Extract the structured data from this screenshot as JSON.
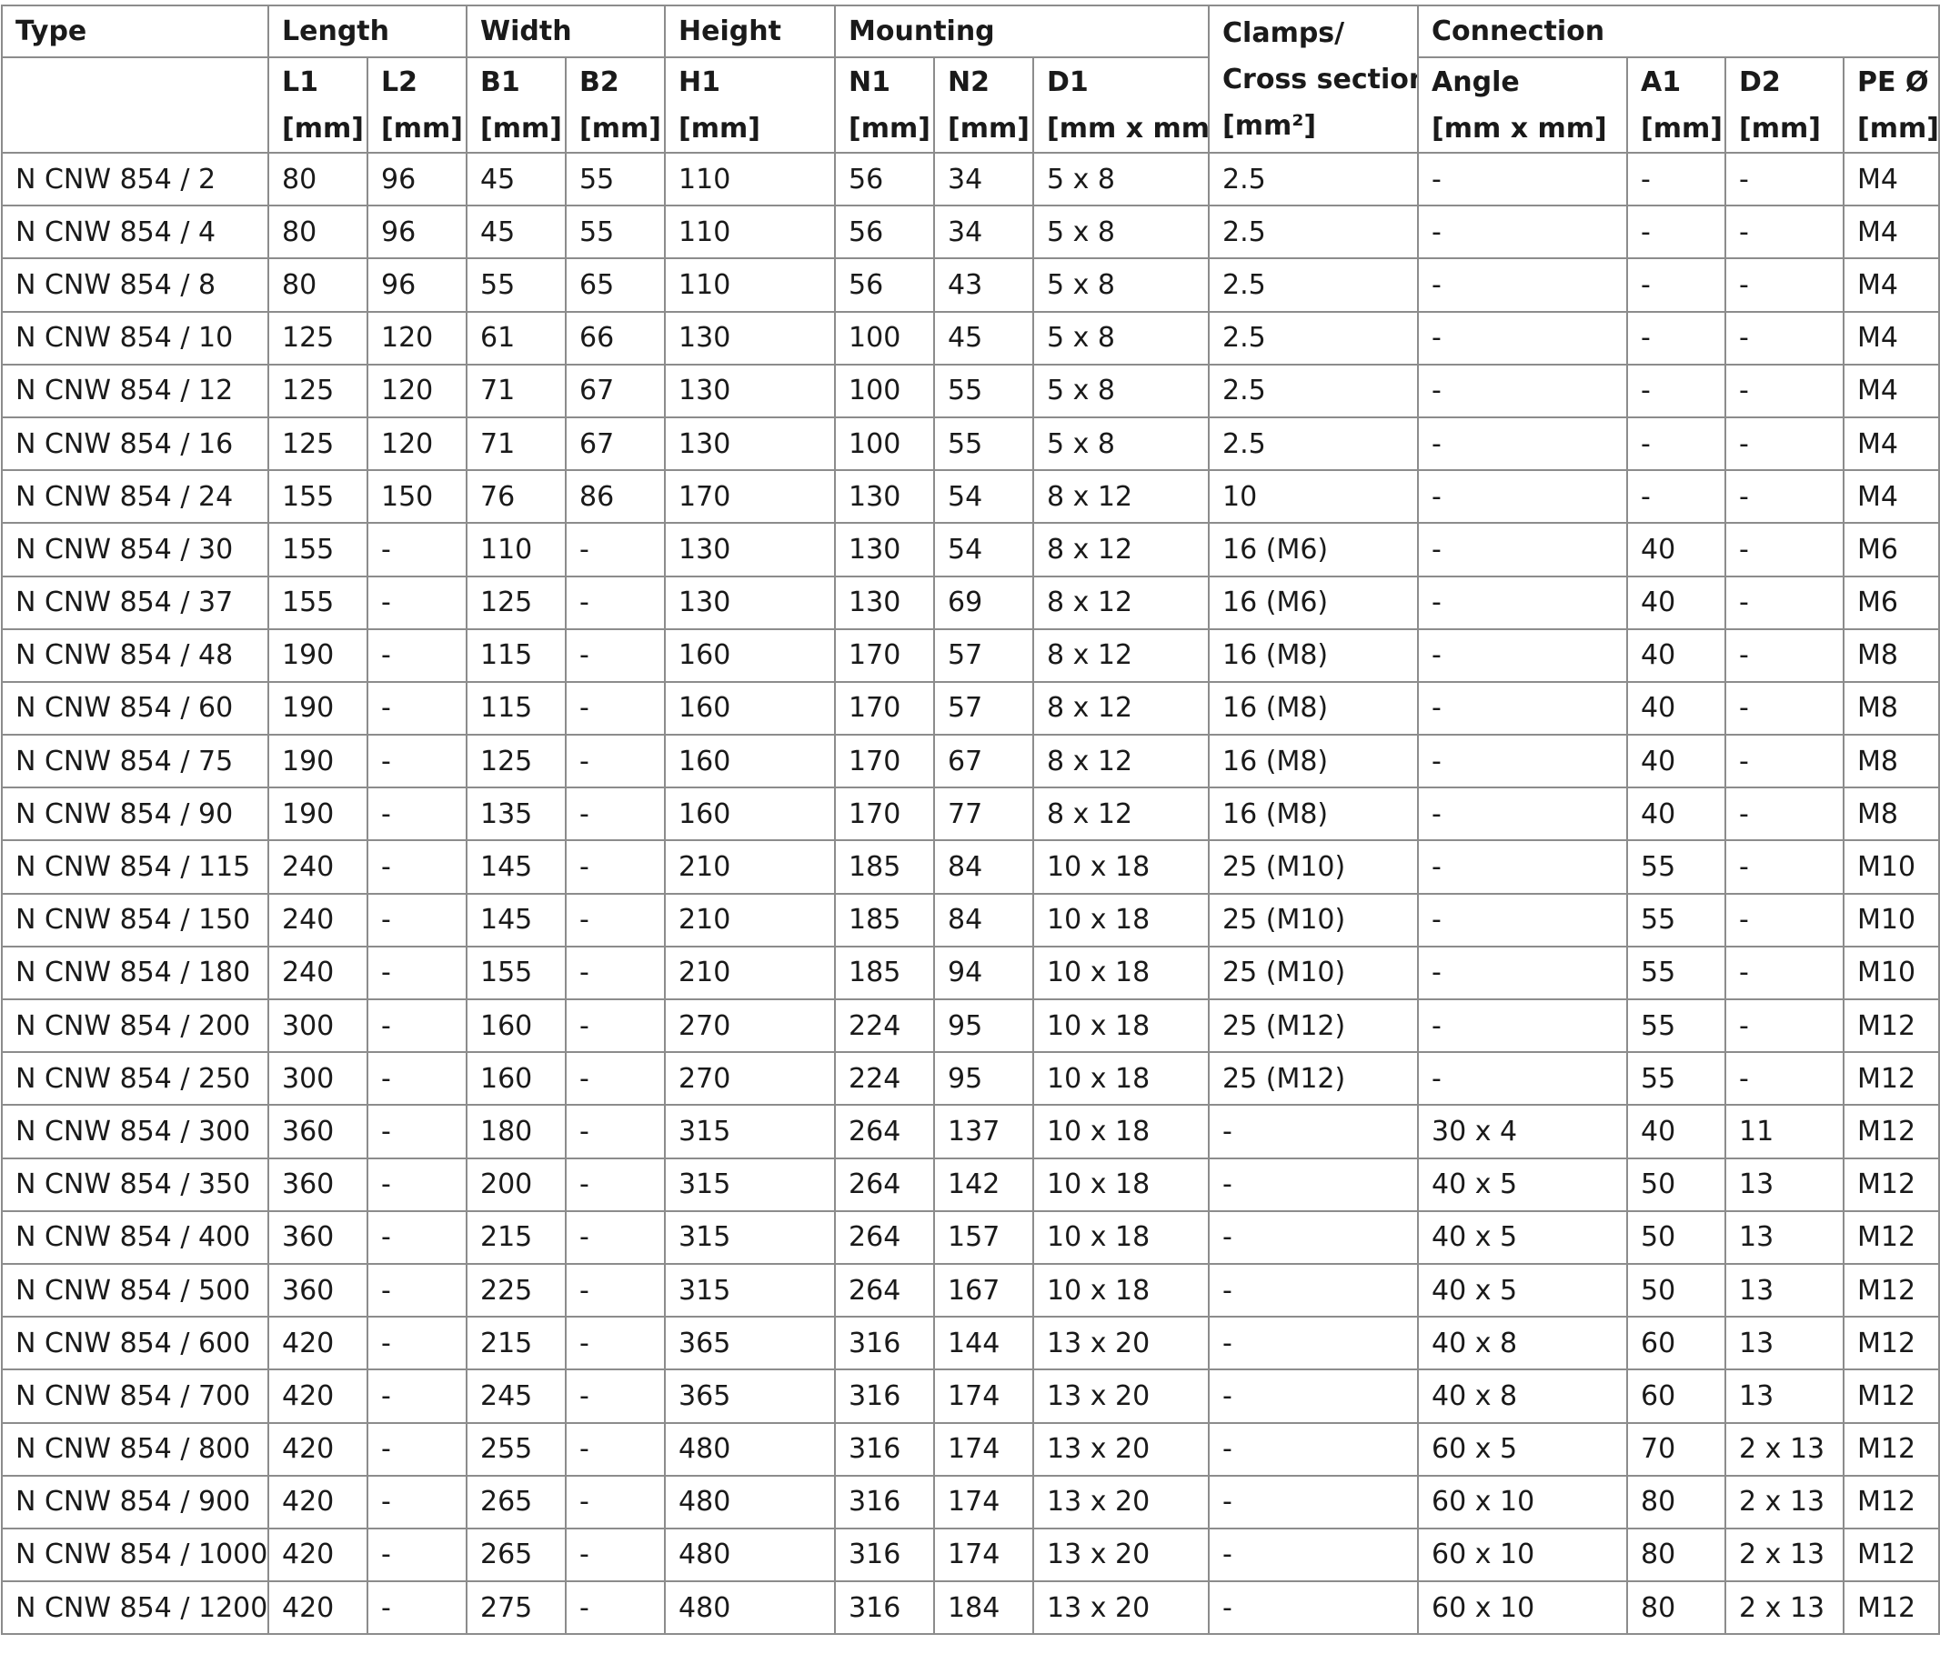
{
  "table": {
    "header": {
      "type": "Type",
      "length": "Length",
      "width": "Width",
      "height": "Height",
      "mounting": "Mounting",
      "clamps_line1": "Clamps/",
      "clamps_line2": "Cross section",
      "clamps_unit": "[mm²]",
      "connection": "Connection"
    },
    "subheaders": [
      {
        "name": "L1",
        "unit": "[mm]"
      },
      {
        "name": "L2",
        "unit": "[mm]"
      },
      {
        "name": "B1",
        "unit": "[mm]"
      },
      {
        "name": "B2",
        "unit": "[mm]"
      },
      {
        "name": "H1",
        "unit": "[mm]"
      },
      {
        "name": "N1",
        "unit": "[mm]"
      },
      {
        "name": "N2",
        "unit": "[mm]"
      },
      {
        "name": "D1",
        "unit": "[mm x mm]"
      },
      {
        "name": "Angle",
        "unit": "[mm x mm]"
      },
      {
        "name": "A1",
        "unit": "[mm]"
      },
      {
        "name": "D2",
        "unit": "[mm]"
      },
      {
        "name": "PE Ø",
        "unit": "[mm]"
      }
    ],
    "rows": [
      [
        "N CNW 854 / 2",
        "80",
        "96",
        "45",
        "55",
        "110",
        "56",
        "34",
        "5 x 8",
        "2.5",
        "-",
        "-",
        "-",
        "M4"
      ],
      [
        "N CNW 854 / 4",
        "80",
        "96",
        "45",
        "55",
        "110",
        "56",
        "34",
        "5 x 8",
        "2.5",
        "-",
        "-",
        "-",
        "M4"
      ],
      [
        "N CNW 854 / 8",
        "80",
        "96",
        "55",
        "65",
        "110",
        "56",
        "43",
        "5 x 8",
        "2.5",
        "-",
        "-",
        "-",
        "M4"
      ],
      [
        "N CNW 854 / 10",
        "125",
        "120",
        "61",
        "66",
        "130",
        "100",
        "45",
        "5 x 8",
        "2.5",
        "-",
        "-",
        "-",
        "M4"
      ],
      [
        "N CNW 854 / 12",
        "125",
        "120",
        "71",
        "67",
        "130",
        "100",
        "55",
        "5 x 8",
        "2.5",
        "-",
        "-",
        "-",
        "M4"
      ],
      [
        "N CNW 854 / 16",
        "125",
        "120",
        "71",
        "67",
        "130",
        "100",
        "55",
        "5 x 8",
        "2.5",
        "-",
        "-",
        "-",
        "M4"
      ],
      [
        "N CNW 854 / 24",
        "155",
        "150",
        "76",
        "86",
        "170",
        "130",
        "54",
        "8 x 12",
        "10",
        "-",
        "-",
        "-",
        "M4"
      ],
      [
        "N CNW 854 / 30",
        "155",
        "-",
        "110",
        "-",
        "130",
        "130",
        "54",
        "8 x 12",
        "16 (M6)",
        "-",
        "40",
        "-",
        "M6"
      ],
      [
        "N CNW 854 / 37",
        "155",
        "-",
        "125",
        "-",
        "130",
        "130",
        "69",
        "8 x 12",
        "16 (M6)",
        "-",
        "40",
        "-",
        "M6"
      ],
      [
        "N CNW 854 / 48",
        "190",
        "-",
        "115",
        "-",
        "160",
        "170",
        "57",
        "8 x 12",
        "16 (M8)",
        "-",
        "40",
        "-",
        "M8"
      ],
      [
        "N CNW 854 / 60",
        "190",
        "-",
        "115",
        "-",
        "160",
        "170",
        "57",
        "8 x 12",
        "16 (M8)",
        "-",
        "40",
        "-",
        "M8"
      ],
      [
        "N CNW 854 / 75",
        "190",
        "-",
        "125",
        "-",
        "160",
        "170",
        "67",
        "8 x 12",
        "16 (M8)",
        "-",
        "40",
        "-",
        "M8"
      ],
      [
        "N CNW 854 / 90",
        "190",
        "-",
        "135",
        "-",
        "160",
        "170",
        "77",
        "8 x 12",
        "16 (M8)",
        "-",
        "40",
        "-",
        "M8"
      ],
      [
        "N CNW 854 / 115",
        "240",
        "-",
        "145",
        "-",
        "210",
        "185",
        "84",
        "10 x 18",
        "25 (M10)",
        "-",
        "55",
        "-",
        "M10"
      ],
      [
        "N CNW 854 / 150",
        "240",
        "-",
        "145",
        "-",
        "210",
        "185",
        "84",
        "10 x 18",
        "25 (M10)",
        "-",
        "55",
        "-",
        "M10"
      ],
      [
        "N CNW 854 / 180",
        "240",
        "-",
        "155",
        "-",
        "210",
        "185",
        "94",
        "10 x 18",
        "25 (M10)",
        "-",
        "55",
        "-",
        "M10"
      ],
      [
        "N CNW 854 / 200",
        "300",
        "-",
        "160",
        "-",
        "270",
        "224",
        "95",
        "10 x 18",
        "25 (M12)",
        "-",
        "55",
        "-",
        "M12"
      ],
      [
        "N CNW 854 / 250",
        "300",
        "-",
        "160",
        "-",
        "270",
        "224",
        "95",
        "10 x 18",
        "25 (M12)",
        "-",
        "55",
        "-",
        "M12"
      ],
      [
        "N CNW 854 / 300",
        "360",
        "-",
        "180",
        "-",
        "315",
        "264",
        "137",
        "10 x 18",
        "-",
        "30 x 4",
        "40",
        "11",
        "M12"
      ],
      [
        "N CNW 854 / 350",
        "360",
        "-",
        "200",
        "-",
        "315",
        "264",
        "142",
        "10 x 18",
        "-",
        "40 x 5",
        "50",
        "13",
        "M12"
      ],
      [
        "N CNW 854 / 400",
        "360",
        "-",
        "215",
        "-",
        "315",
        "264",
        "157",
        "10 x 18",
        "-",
        "40 x 5",
        "50",
        "13",
        "M12"
      ],
      [
        "N CNW 854 / 500",
        "360",
        "-",
        "225",
        "-",
        "315",
        "264",
        "167",
        "10 x 18",
        "-",
        "40 x 5",
        "50",
        "13",
        "M12"
      ],
      [
        "N CNW 854 / 600",
        "420",
        "-",
        "215",
        "-",
        "365",
        "316",
        "144",
        "13 x 20",
        "-",
        "40 x 8",
        "60",
        "13",
        "M12"
      ],
      [
        "N CNW 854 / 700",
        "420",
        "-",
        "245",
        "-",
        "365",
        "316",
        "174",
        "13 x 20",
        "-",
        "40 x 8",
        "60",
        "13",
        "M12"
      ],
      [
        "N CNW 854 / 800",
        "420",
        "-",
        "255",
        "-",
        "480",
        "316",
        "174",
        "13 x 20",
        "-",
        "60 x 5",
        "70",
        "2 x 13",
        "M12"
      ],
      [
        "N  CNW 854 / 900",
        "420",
        "-",
        "265",
        "-",
        "480",
        "316",
        "174",
        "13 x 20",
        "-",
        "60 x 10",
        "80",
        "2 x 13",
        "M12"
      ],
      [
        "N CNW 854 / 1000",
        "420",
        "-",
        "265",
        "-",
        "480",
        "316",
        "174",
        "13 x 20",
        "-",
        "60 x 10",
        "80",
        "2 x 13",
        "M12"
      ],
      [
        "N CNW 854 / 1200",
        "420",
        "-",
        "275",
        "-",
        "480",
        "316",
        "184",
        "13 x 20",
        "-",
        "60 x 10",
        "80",
        "2 x 13",
        "M12"
      ]
    ]
  }
}
